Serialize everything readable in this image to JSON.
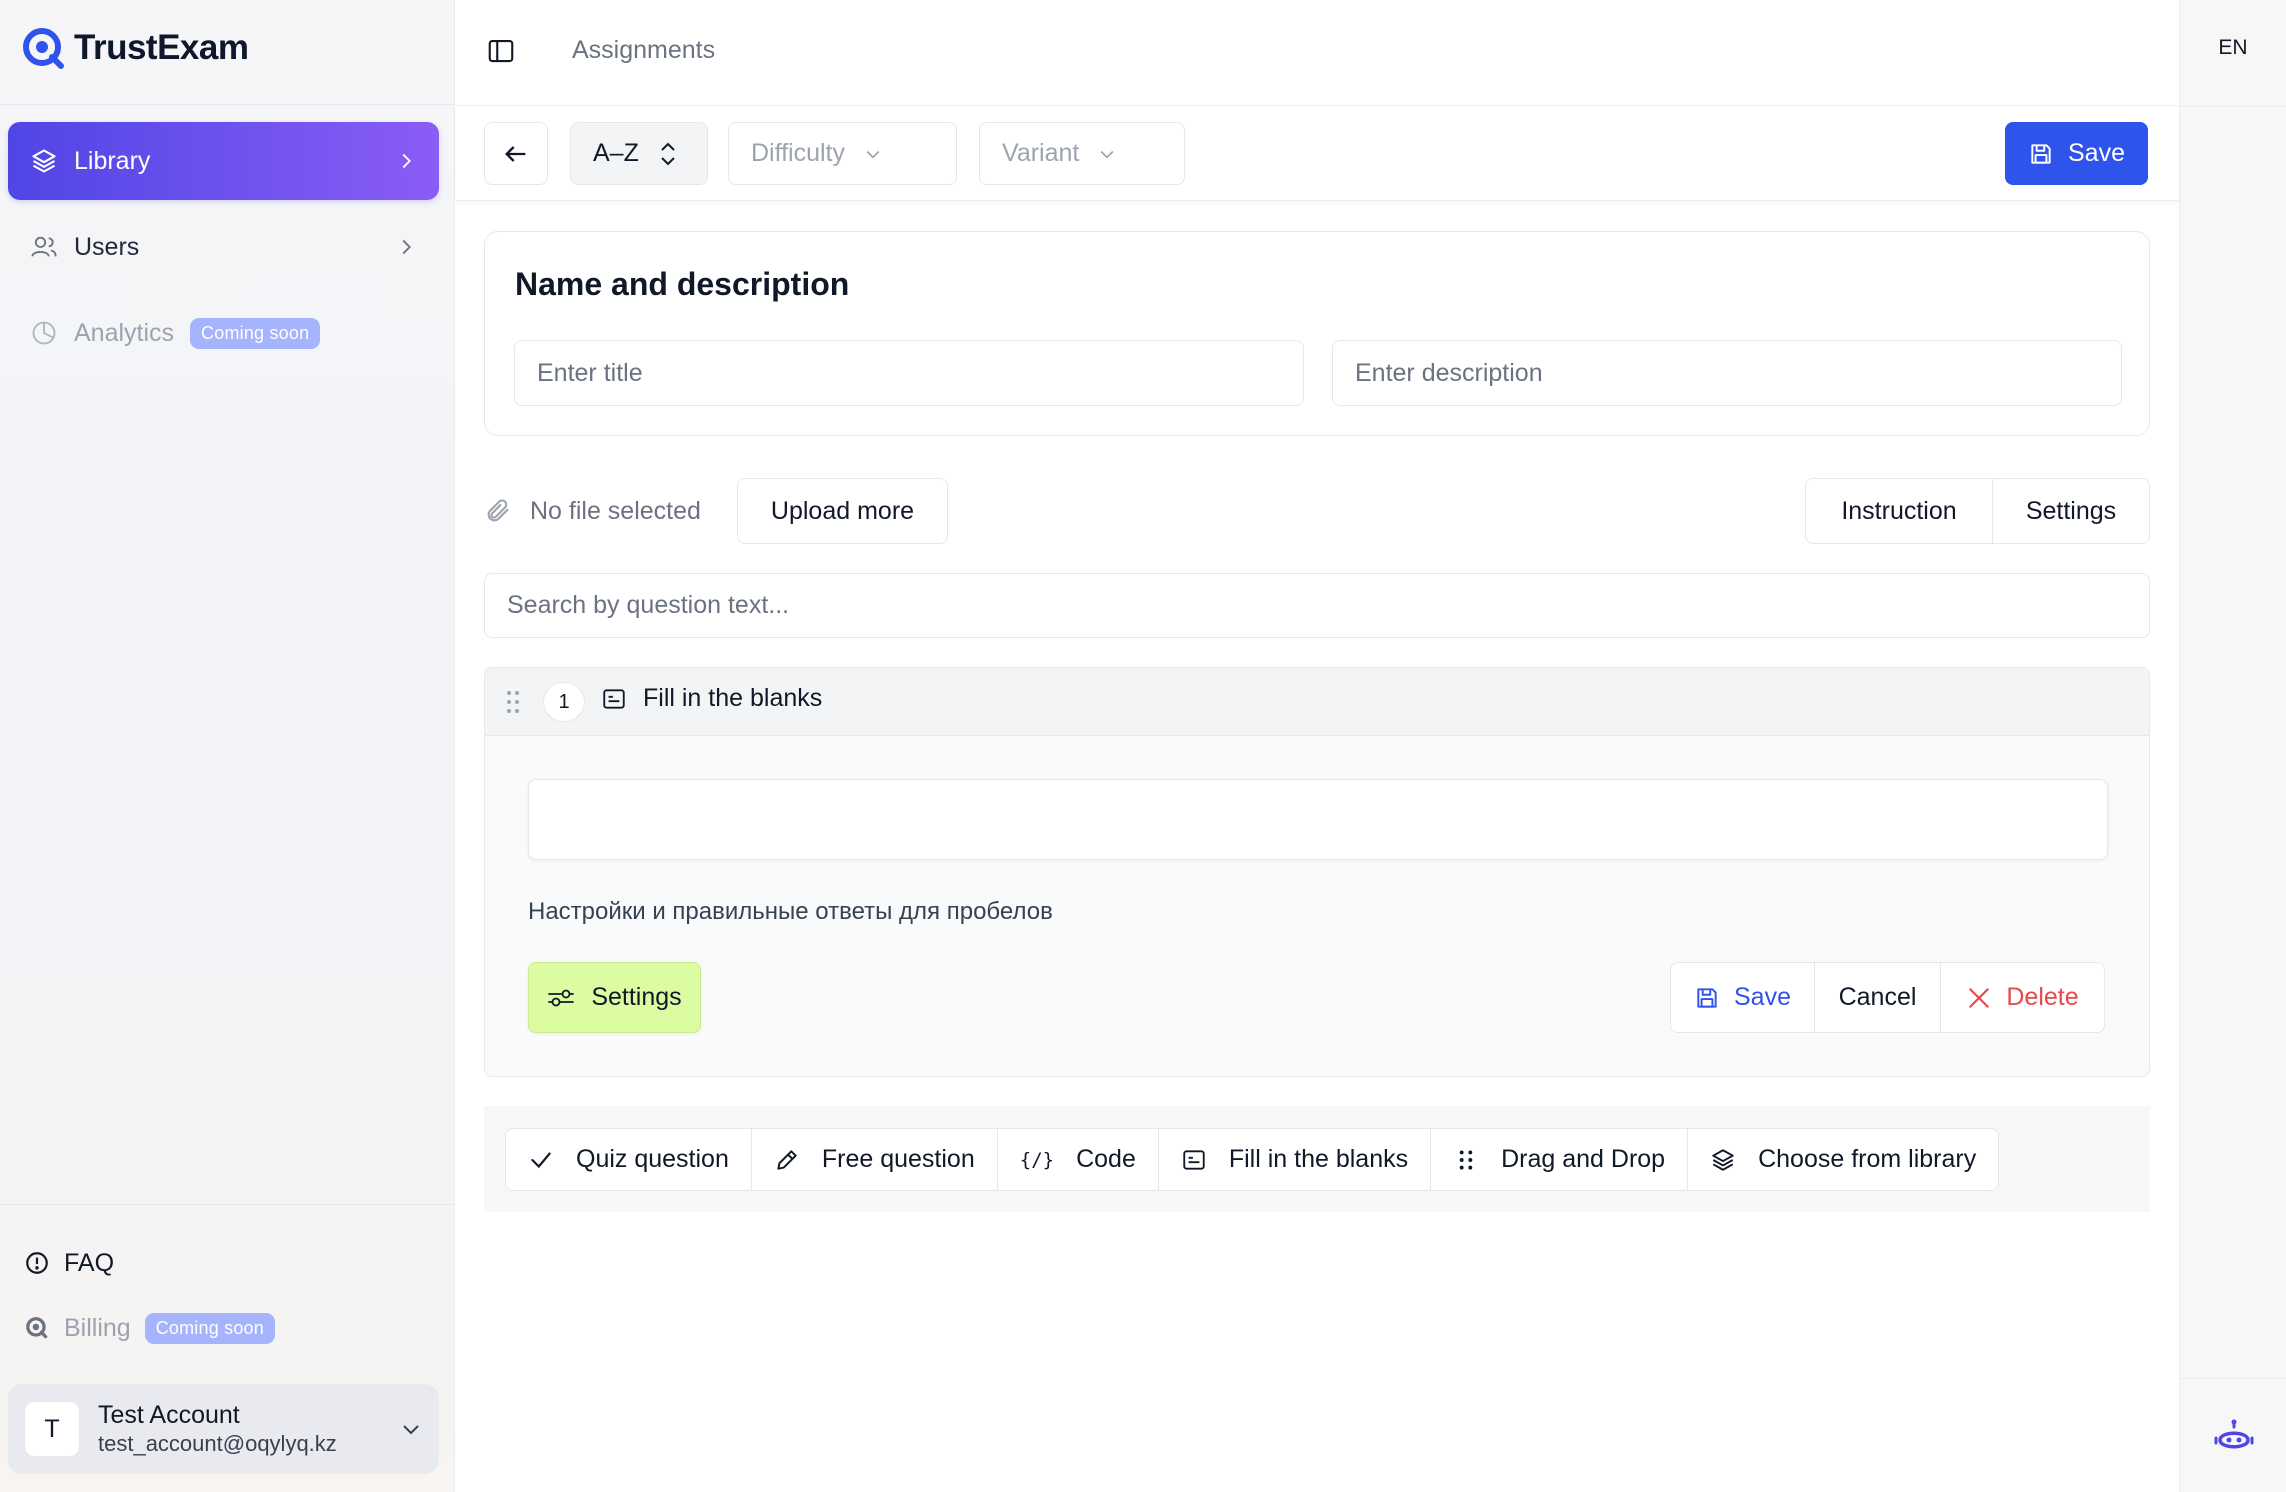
{
  "app": {
    "name": "TrustExam"
  },
  "sidebar": {
    "items": [
      {
        "label": "Library",
        "active": true
      },
      {
        "label": "Users"
      },
      {
        "label": "Analytics",
        "badge": "Coming soon",
        "disabled": true
      }
    ],
    "bottom": [
      {
        "label": "FAQ"
      },
      {
        "label": "Billing",
        "badge": "Coming soon",
        "disabled": true
      }
    ],
    "account": {
      "initial": "T",
      "name": "Test Account",
      "email": "test_account@oqylyq.kz"
    }
  },
  "header": {
    "breadcrumb": "Assignments",
    "language": "EN"
  },
  "toolbar": {
    "sort_label": "A–Z",
    "difficulty_label": "Difficulty",
    "variant_label": "Variant",
    "save_label": "Save"
  },
  "name_card": {
    "title": "Name and description",
    "title_placeholder": "Enter title",
    "description_placeholder": "Enter description"
  },
  "files": {
    "status": "No file selected",
    "upload_label": "Upload more",
    "instruction_label": "Instruction",
    "settings_label": "Settings"
  },
  "search": {
    "placeholder": "Search by question text..."
  },
  "question": {
    "number": "1",
    "type_label": "Fill in the blanks",
    "hint": "Настройки и правильные ответы для пробелов",
    "settings_label": "Settings",
    "save_label": "Save",
    "cancel_label": "Cancel",
    "delete_label": "Delete"
  },
  "add_question": [
    {
      "label": "Quiz question",
      "icon": "check-icon"
    },
    {
      "label": "Free question",
      "icon": "pencil-icon"
    },
    {
      "label": "Code",
      "icon": "code-icon",
      "glyph": "{/}"
    },
    {
      "label": "Fill in the blanks",
      "icon": "fill-blanks-icon"
    },
    {
      "label": "Drag and Drop",
      "icon": "drag-dots-icon"
    },
    {
      "label": "Choose from library",
      "icon": "layers-icon"
    }
  ],
  "colors": {
    "accent": "#2f54eb",
    "active_gradient_start": "#4f46e5",
    "active_gradient_end": "#8b5cf6",
    "badge": "#a5b4fc",
    "danger": "#e5484d",
    "settings_green": "#dcfca1"
  }
}
